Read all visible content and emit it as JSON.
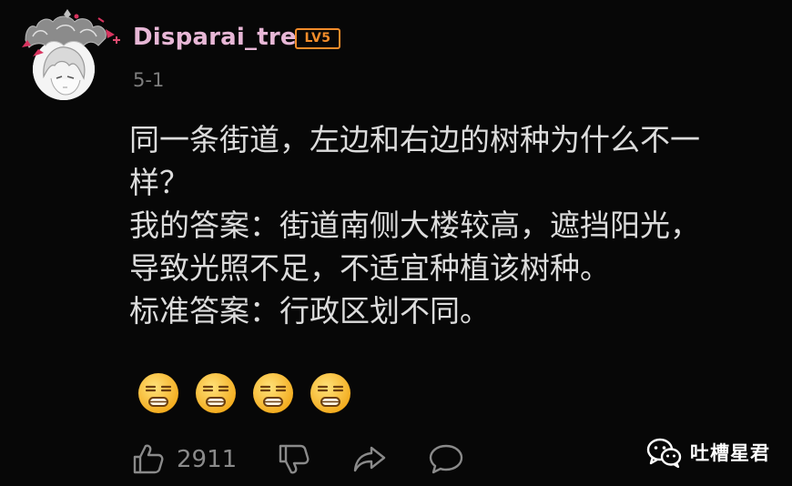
{
  "comment": {
    "author": {
      "username": "Disparai_tre",
      "level_badge": "LV5"
    },
    "date": "5-1",
    "lines": [
      "同一条街道，左边和右边的树种为什么不一",
      "样？",
      "我的答案：街道南侧大楼较高，遮挡阳光，",
      "导致光照不足，不适宜种植该树种。",
      "标准答案：行政区划不同。"
    ],
    "emojis": [
      "speechless-face",
      "speechless-face",
      "speechless-face",
      "speechless-face"
    ]
  },
  "actions": {
    "like_count": "2911",
    "icons": [
      "thumbs-up-icon",
      "thumbs-down-icon",
      "share-icon",
      "reply-icon"
    ]
  },
  "watermark": {
    "text": "吐槽星君",
    "icon": "wechat-icon"
  },
  "colors": {
    "background": "#070707",
    "username": "#e7b7d6",
    "level_badge": "#f28c2a",
    "body_text": "#dcdcdc",
    "muted_text": "#8a8a8a"
  }
}
